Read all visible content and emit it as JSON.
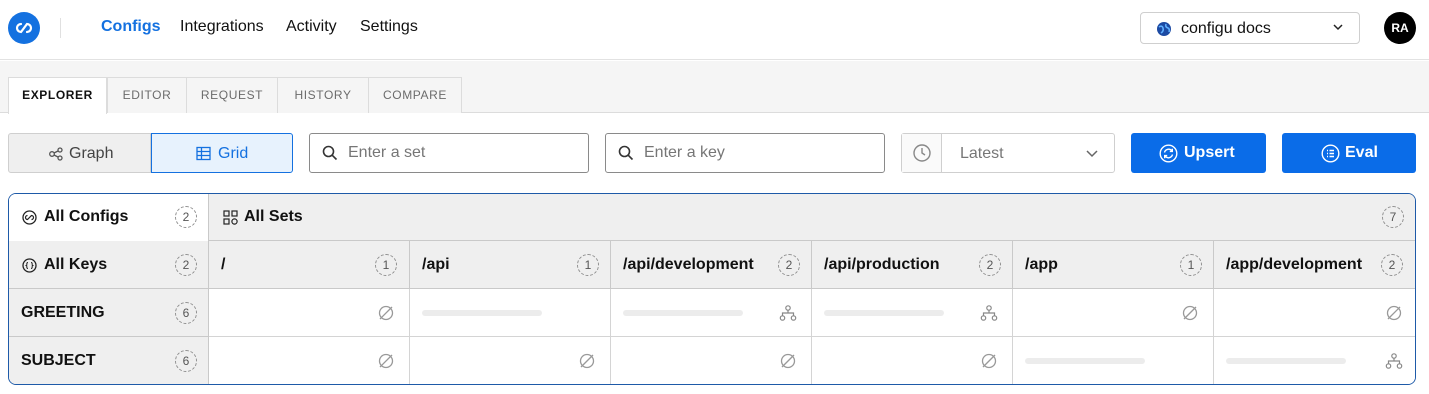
{
  "nav": {
    "items": [
      {
        "label": "Configs",
        "active": true
      },
      {
        "label": "Integrations",
        "active": false
      },
      {
        "label": "Activity",
        "active": false
      },
      {
        "label": "Settings",
        "active": false
      }
    ],
    "project": "configu docs",
    "avatar_initials": "RA"
  },
  "tabs": [
    {
      "label": "EXPLORER",
      "active": true
    },
    {
      "label": "EDITOR",
      "active": false
    },
    {
      "label": "REQUEST",
      "active": false
    },
    {
      "label": "HISTORY",
      "active": false
    },
    {
      "label": "COMPARE",
      "active": false
    }
  ],
  "toolbar": {
    "view_graph_label": "Graph",
    "view_grid_label": "Grid",
    "selected_view": "Grid",
    "set_search_placeholder": "Enter a set",
    "key_search_placeholder": "Enter a key",
    "time_value": "Latest",
    "upsert_label": "Upsert",
    "eval_label": "Eval"
  },
  "grid": {
    "all_configs_label": "All Configs",
    "all_configs_count": "2",
    "all_sets_label": "All Sets",
    "all_sets_count": "7",
    "all_keys_label": "All Keys",
    "all_keys_count": "2",
    "sets": [
      {
        "path": "/",
        "count": "1"
      },
      {
        "path": "/api",
        "count": "1"
      },
      {
        "path": "/api/development",
        "count": "2"
      },
      {
        "path": "/api/production",
        "count": "2"
      },
      {
        "path": "/app",
        "count": "1"
      },
      {
        "path": "/app/development",
        "count": "2"
      }
    ],
    "rows": [
      {
        "key": "GREETING",
        "count": "6",
        "cells": [
          "empty",
          "value",
          "inherited",
          "inherited",
          "empty",
          "empty"
        ]
      },
      {
        "key": "SUBJECT",
        "count": "6",
        "cells": [
          "empty",
          "empty",
          "empty",
          "empty",
          "value",
          "inherited"
        ]
      }
    ]
  },
  "colors": {
    "accent": "#1471e0",
    "primary_button": "#0a6ce8",
    "grid_border": "#1e5aa8",
    "header_bg": "#efefef"
  },
  "icons": {
    "logo": "configu-logo-icon",
    "graph": "graph-icon",
    "grid": "table-icon",
    "search": "search-icon",
    "clock": "clock-icon",
    "upsert": "refresh-icon",
    "eval": "list-icon",
    "empty_cell": "empty-set-icon",
    "inherited_cell": "hierarchy-icon"
  }
}
